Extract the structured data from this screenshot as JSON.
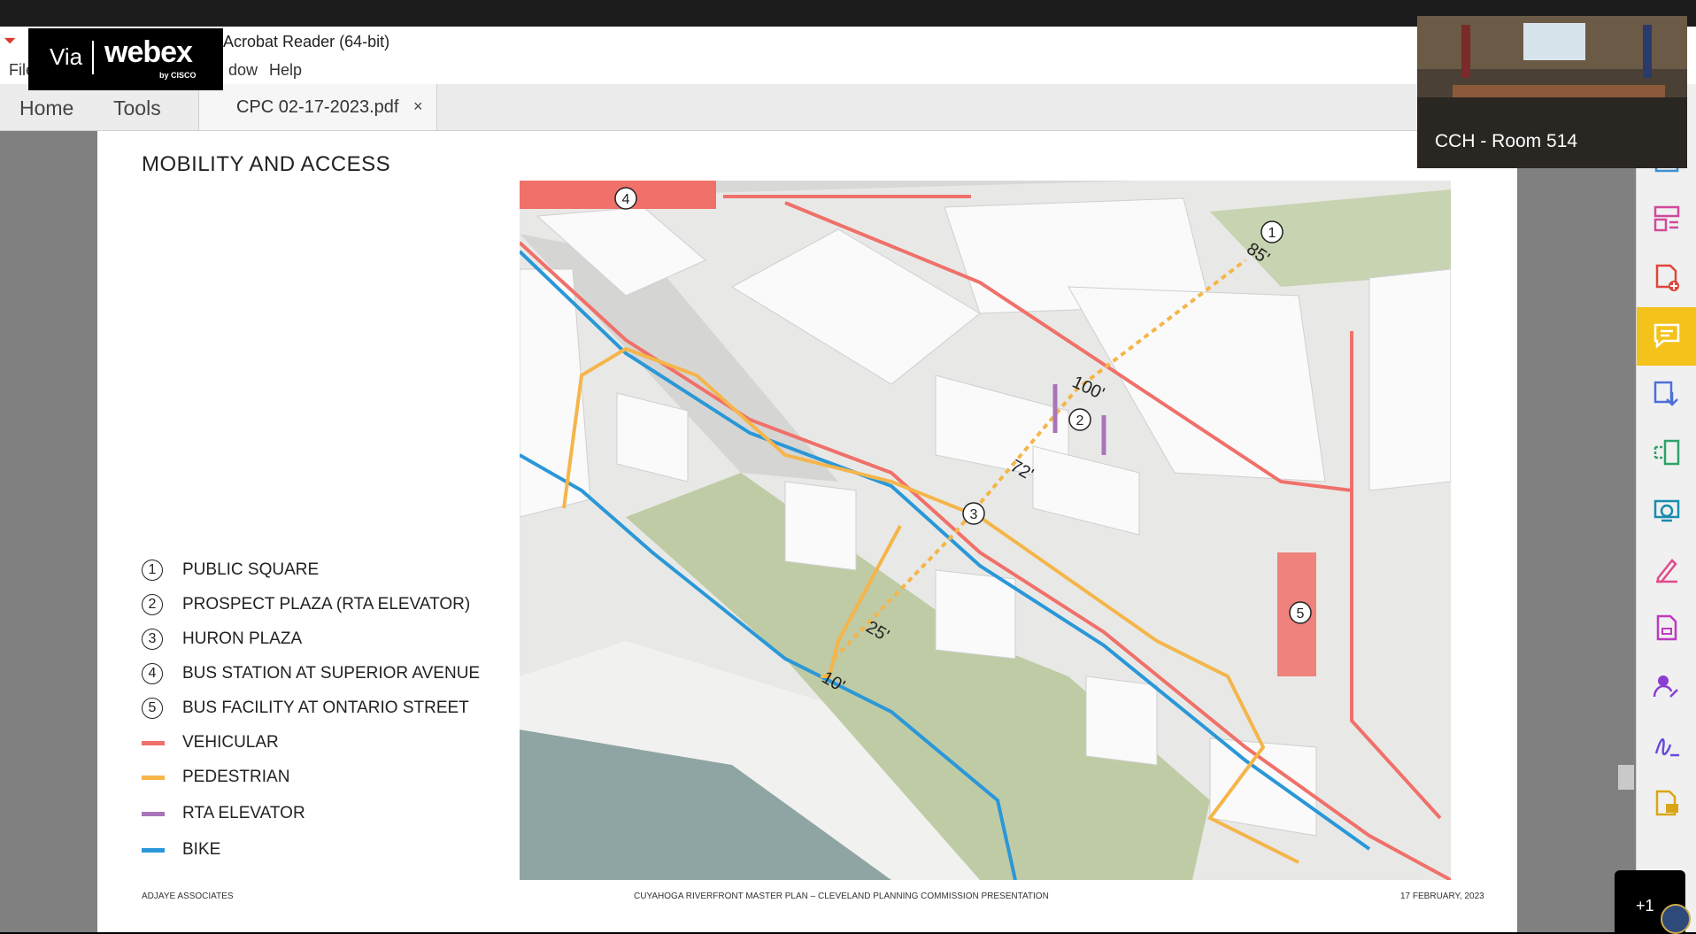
{
  "window": {
    "app_title": "Adobe Acrobat Reader (64-bit)",
    "visible_title": "e Acrobat Reader (64-bit)"
  },
  "menu": {
    "file": "File",
    "window": "dow",
    "help": "Help"
  },
  "tabs": {
    "home": "Home",
    "tools": "Tools",
    "doc": "CPC 02-17-2023.pdf",
    "close": "×"
  },
  "webex": {
    "via": "Via",
    "brand": "webex",
    "by": "by CISCO"
  },
  "video": {
    "label": "CCH - Room 514"
  },
  "badge": {
    "text": "+1"
  },
  "page": {
    "heading": "MOBILITY AND ACCESS",
    "legend": [
      {
        "num": "1",
        "text": "PUBLIC SQUARE"
      },
      {
        "num": "2",
        "text": "PROSPECT PLAZA (RTA ELEVATOR)"
      },
      {
        "num": "3",
        "text": "HURON PLAZA"
      },
      {
        "num": "4",
        "text": "BUS STATION AT SUPERIOR AVENUE"
      },
      {
        "num": "5",
        "text": "BUS FACILITY AT ONTARIO STREET"
      }
    ],
    "line_legend": [
      {
        "text": "VEHICULAR",
        "color": "#f0706a"
      },
      {
        "text": "PEDESTRIAN",
        "color": "#f5b54a"
      },
      {
        "text": "RTA ELEVATOR",
        "color": "#a875b8"
      },
      {
        "text": "BIKE",
        "color": "#2a97d8"
      }
    ],
    "footer_left": "ADJAYE ASSOCIATES",
    "footer_center": "CUYAHOGA RIVERFRONT MASTER PLAN – CLEVELAND PLANNING COMMISSION PRESENTATION",
    "footer_right": "17 FEBRUARY, 2023"
  },
  "map": {
    "markers": [
      "4",
      "1",
      "2",
      "3",
      "5"
    ],
    "dims": [
      "85'",
      "100'",
      "72'",
      "25'",
      "10'"
    ]
  },
  "right_tools": [
    {
      "name": "export-pdf-icon",
      "color": "#3b8fd6"
    },
    {
      "name": "organize-pages-icon",
      "color": "#d04a9a"
    },
    {
      "name": "create-pdf-icon",
      "color": "#e0453a"
    },
    {
      "name": "comment-icon",
      "color": "#ffffff"
    },
    {
      "name": "scan-ocr-icon",
      "color": "#4b6fd8"
    },
    {
      "name": "compress-pdf-icon",
      "color": "#2da36a"
    },
    {
      "name": "protect-icon",
      "color": "#1a8cae"
    },
    {
      "name": "fill-sign-icon",
      "color": "#e04a8c"
    },
    {
      "name": "edit-pdf-icon",
      "color": "#c03ac0"
    },
    {
      "name": "request-signature-icon",
      "color": "#8b3ed0"
    },
    {
      "name": "sign-icon",
      "color": "#6a4ae0"
    },
    {
      "name": "stamp-note-icon",
      "color": "#d9a516"
    }
  ]
}
